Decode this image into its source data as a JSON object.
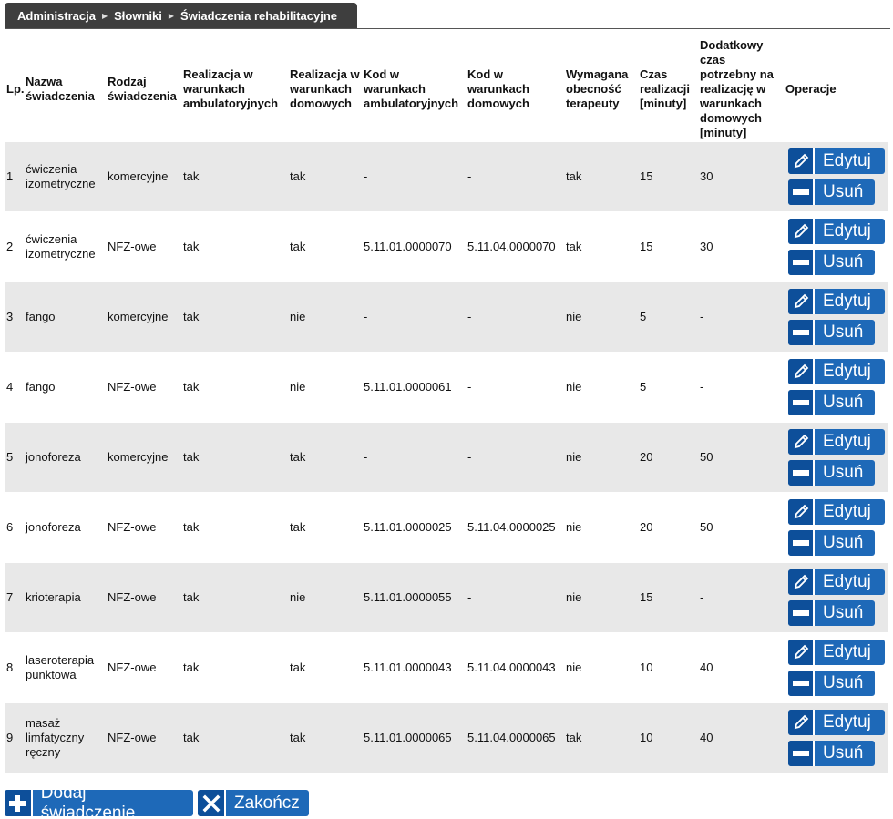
{
  "breadcrumb": [
    "Administracja",
    "Słowniki",
    "Świadczenia rehabilitacyjne"
  ],
  "table": {
    "headers": {
      "lp": "Lp.",
      "name": "Nazwa świadczenia",
      "type": "Rodzaj świadczenia",
      "amb": "Realizacja w warunkach ambulatoryjnych",
      "home": "Realizacja w warunkach domowych",
      "code_amb": "Kod w warunkach ambulatoryjnych",
      "code_home": "Kod w warunkach domowych",
      "therapist": "Wymagana obecność terapeuty",
      "time": "Czas realizacji [minuty]",
      "extra": "Dodatkowy czas potrzebny na realizację w warunkach domowych [minuty]",
      "ops": "Operacje"
    },
    "rows": [
      {
        "lp": "1",
        "name": "ćwiczenia izometryczne",
        "type": "komercyjne",
        "amb": "tak",
        "home": "tak",
        "code_amb": "-",
        "code_home": "-",
        "therapist": "tak",
        "time": "15",
        "extra": "30"
      },
      {
        "lp": "2",
        "name": "ćwiczenia izometryczne",
        "type": "NFZ-owe",
        "amb": "tak",
        "home": "tak",
        "code_amb": "5.11.01.0000070",
        "code_home": "5.11.04.0000070",
        "therapist": "tak",
        "time": "15",
        "extra": "30"
      },
      {
        "lp": "3",
        "name": "fango",
        "type": "komercyjne",
        "amb": "tak",
        "home": "nie",
        "code_amb": "-",
        "code_home": "-",
        "therapist": "nie",
        "time": "5",
        "extra": "-"
      },
      {
        "lp": "4",
        "name": "fango",
        "type": "NFZ-owe",
        "amb": "tak",
        "home": "nie",
        "code_amb": "5.11.01.0000061",
        "code_home": "-",
        "therapist": "nie",
        "time": "5",
        "extra": "-"
      },
      {
        "lp": "5",
        "name": "jonoforeza",
        "type": "komercyjne",
        "amb": "tak",
        "home": "tak",
        "code_amb": "-",
        "code_home": "-",
        "therapist": "nie",
        "time": "20",
        "extra": "50"
      },
      {
        "lp": "6",
        "name": "jonoforeza",
        "type": "NFZ-owe",
        "amb": "tak",
        "home": "tak",
        "code_amb": "5.11.01.0000025",
        "code_home": "5.11.04.0000025",
        "therapist": "nie",
        "time": "20",
        "extra": "50"
      },
      {
        "lp": "7",
        "name": "krioterapia",
        "type": "NFZ-owe",
        "amb": "tak",
        "home": "nie",
        "code_amb": "5.11.01.0000055",
        "code_home": "-",
        "therapist": "nie",
        "time": "15",
        "extra": "-"
      },
      {
        "lp": "8",
        "name": "laseroterapia punktowa",
        "type": "NFZ-owe",
        "amb": "tak",
        "home": "tak",
        "code_amb": "5.11.01.0000043",
        "code_home": "5.11.04.0000043",
        "therapist": "nie",
        "time": "10",
        "extra": "40"
      },
      {
        "lp": "9",
        "name": "masaż limfatyczny ręczny",
        "type": "NFZ-owe",
        "amb": "tak",
        "home": "tak",
        "code_amb": "5.11.01.0000065",
        "code_home": "5.11.04.0000065",
        "therapist": "tak",
        "time": "10",
        "extra": "40"
      }
    ],
    "edit_label": "Edytuj",
    "delete_label": "Usuń"
  },
  "actions": {
    "add_label": "Dodaj świadczenie",
    "end_label": "Zakończ"
  },
  "icons": {
    "edit": "pencil-icon",
    "delete": "minus-icon",
    "add": "plus-icon",
    "end": "close-icon"
  },
  "colors": {
    "button": "#1e69b8",
    "button_icon_bg": "#0d4f9a",
    "breadcrumb_bg": "#3e3e3e",
    "row_alt": "#e8e8e8"
  }
}
